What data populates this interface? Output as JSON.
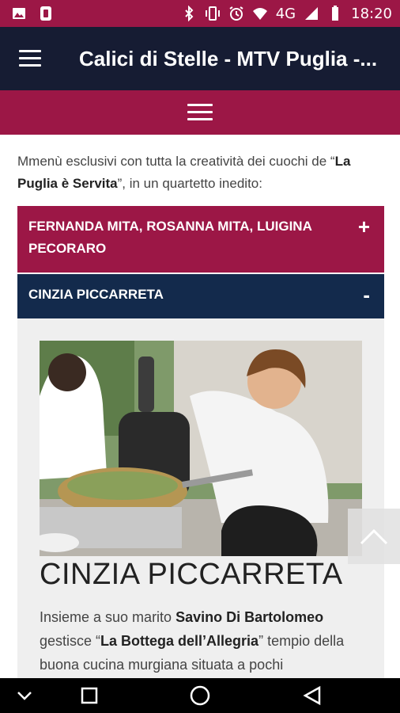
{
  "status_bar": {
    "icons_left": [
      "image-icon",
      "sim-card-icon"
    ],
    "icons_right": [
      "bluetooth-icon",
      "vibrate-icon",
      "alarm-icon",
      "wifi-icon",
      "signal-icon",
      "battery-icon"
    ],
    "network": "4G",
    "time": "18:20"
  },
  "app_bar": {
    "title": "Calici di Stelle - MTV Puglia -..."
  },
  "intro": {
    "text_before": "Mmenù esclusivi con tutta la creatività dei cuochi de “",
    "bold": "La Puglia è Servita",
    "text_after": "”, in un quartetto inedito:"
  },
  "accordion": [
    {
      "label": "FERNANDA MITA, ROSANNA MITA, LUIGINA PECORARO",
      "sign": "+"
    },
    {
      "label": "CINZIA PICCARRETA",
      "sign": "-"
    }
  ],
  "panel": {
    "title": "CINZIA PICCARRETA",
    "p1": "Insieme a suo marito ",
    "b1": "Savino Di Bartolomeo",
    "p2": " gestisce “",
    "b2": "La Bottega dell’Allegria",
    "p3": "” tempio della buona cucina murgiana situata a pochi"
  },
  "colors": {
    "status_bar": "#9c1746",
    "app_bar": "#161c33",
    "accent": "#9c1746",
    "accordion_active": "#132a4c"
  }
}
